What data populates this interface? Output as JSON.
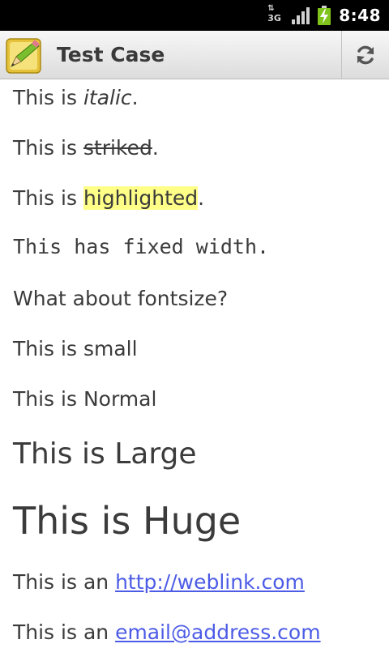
{
  "status_bar": {
    "network_label": "3G",
    "network_arrows": "⇅",
    "time": "8:48"
  },
  "app": {
    "title": "Test Case",
    "icon": "notepad-pencil-icon",
    "refresh_icon": "refresh-icon"
  },
  "lines": {
    "italic": {
      "prefix": "This is ",
      "styled": "italic",
      "suffix": "."
    },
    "striked": {
      "prefix": "This is ",
      "styled": "striked",
      "suffix": "."
    },
    "highlighted": {
      "prefix": "This is ",
      "styled": "highlighted",
      "suffix": "."
    },
    "fixed": "This has fixed width.",
    "fontsize_question": "What about fontsize?",
    "small": "This is small",
    "normal": "This is Normal",
    "large": "This is Large",
    "huge": "This is Huge",
    "weblink": {
      "prefix": "This is an ",
      "link": "http://weblink.com"
    },
    "email": {
      "prefix": "This is an ",
      "link": "email@address.com"
    }
  },
  "colors": {
    "highlight": "#ffff88",
    "link": "#4d5ce6",
    "text": "#3b3b3b"
  }
}
